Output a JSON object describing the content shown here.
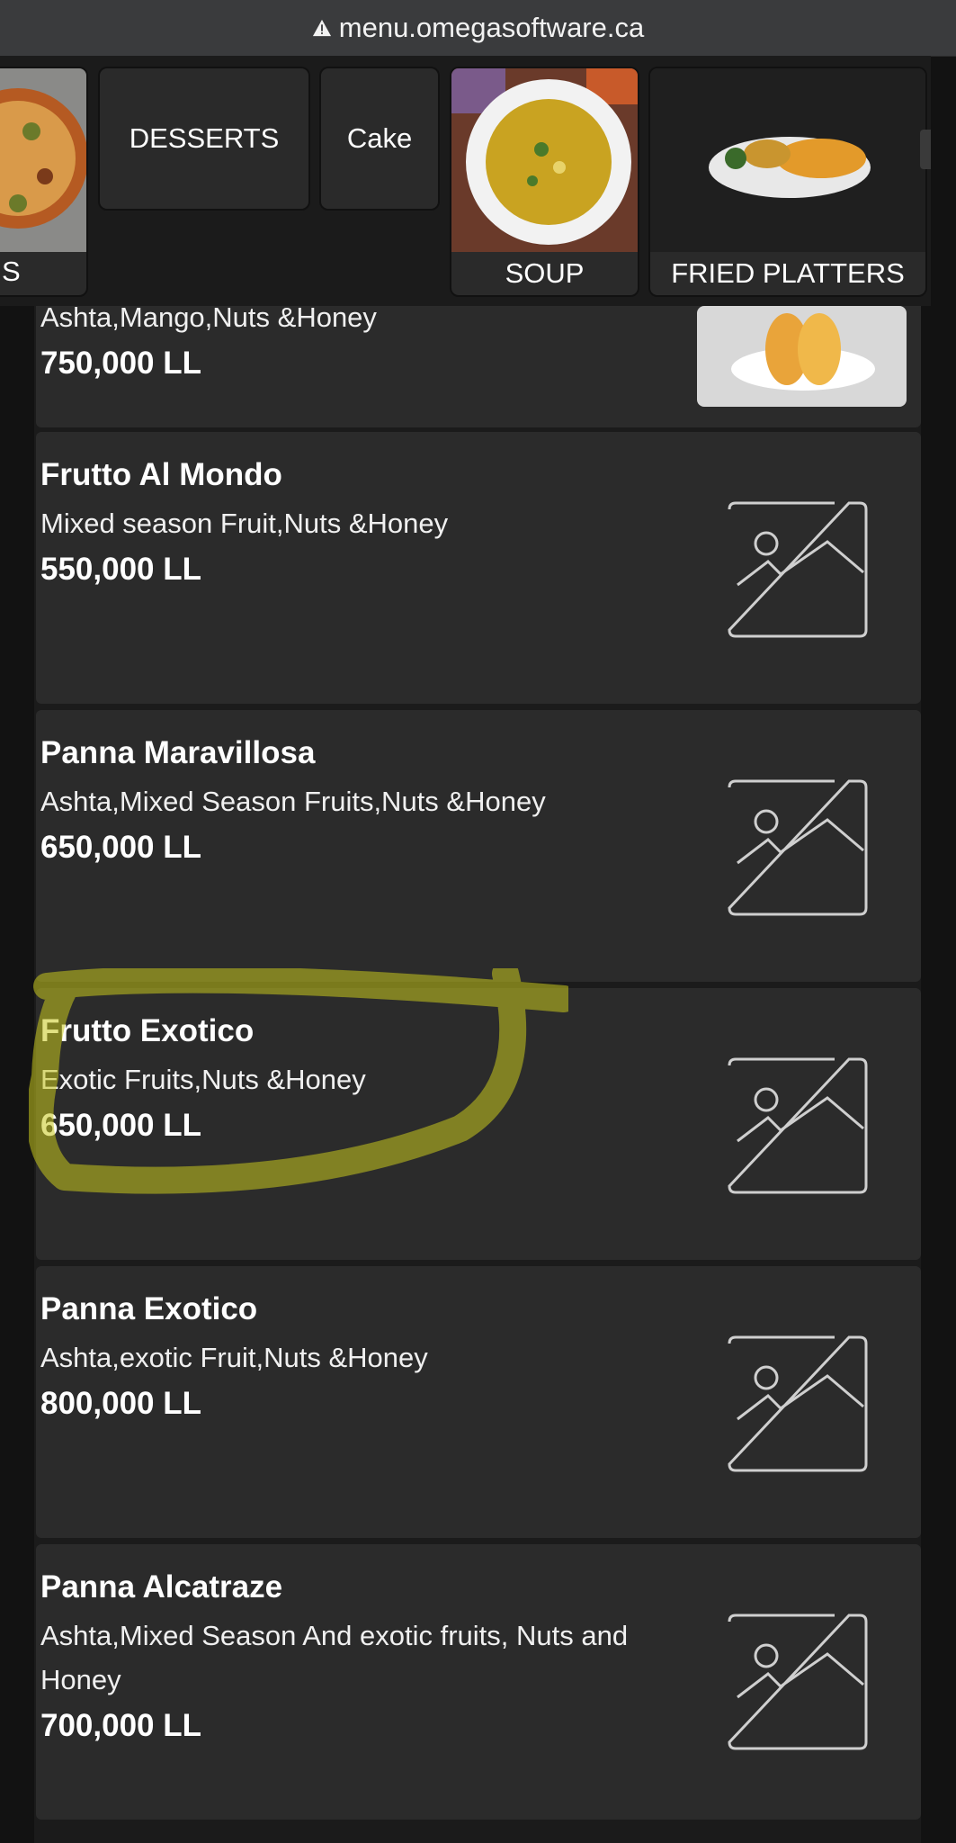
{
  "browser": {
    "url": "menu.omegasoftware.ca"
  },
  "categories": [
    {
      "label": "S"
    },
    {
      "label": "DESSERTS"
    },
    {
      "label": "Cake"
    },
    {
      "label": "SOUP"
    },
    {
      "label": "FRIED PLATTERS"
    }
  ],
  "items": [
    {
      "name": "",
      "desc": "Ashta,Mango,Nuts &Honey",
      "price": "750,000 LL"
    },
    {
      "name": "Frutto Al Mondo",
      "desc": "Mixed season Fruit,Nuts &Honey",
      "price": "550,000 LL"
    },
    {
      "name": "Panna Maravillosa",
      "desc": "Ashta,Mixed Season Fruits,Nuts &Honey",
      "price": "650,000 LL"
    },
    {
      "name": "Frutto Exotico",
      "desc": "Exotic Fruits,Nuts &Honey",
      "price": "650,000 LL"
    },
    {
      "name": "Panna Exotico",
      "desc": "Ashta,exotic Fruit,Nuts &Honey",
      "price": "800,000 LL"
    },
    {
      "name": "Panna Alcatraze",
      "desc": "Ashta,Mixed Season And exotic fruits, Nuts and Honey",
      "price": "700,000 LL"
    }
  ],
  "colors": {
    "highlight": "#c8c81e",
    "card": "#2b2b2b",
    "background": "#121212"
  }
}
